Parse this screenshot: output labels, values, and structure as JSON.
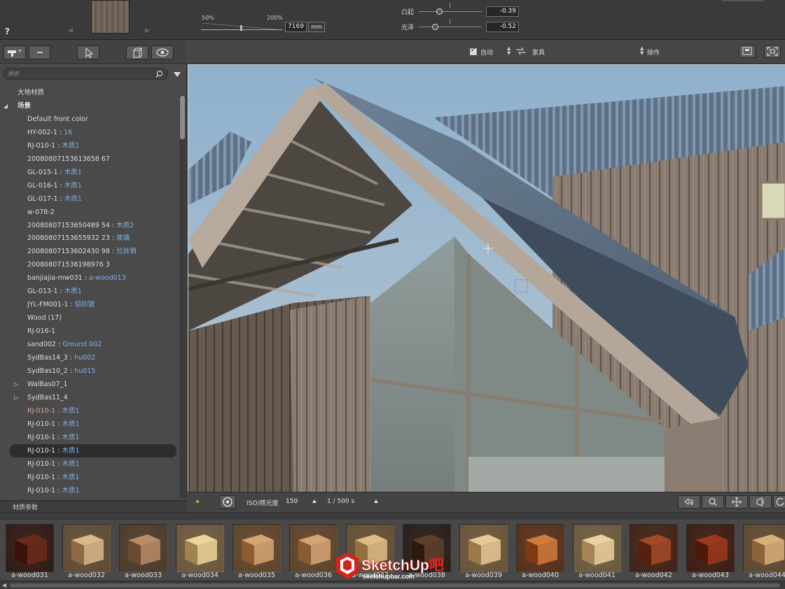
{
  "top": {
    "help": "?",
    "scale_min": "50%",
    "scale_max": "200%",
    "size_value": "7169",
    "size_unit": "mm",
    "params": [
      {
        "label": "凸起",
        "value": "-0.39",
        "level": 0.32
      },
      {
        "label": "光泽",
        "value": "-0.52",
        "level": 0.26
      }
    ]
  },
  "left": {
    "search_placeholder": "搜索",
    "tree": [
      {
        "name": "大地材质",
        "indent": 1
      },
      {
        "name": "场景",
        "indent": 1,
        "arrow": "◢",
        "bold": true
      },
      {
        "name": "Default front color",
        "indent": 2
      },
      {
        "name": "HY-002-1",
        "material": "16",
        "indent": 2
      },
      {
        "name": "RJ-010-1",
        "material": "木质1",
        "indent": 2
      },
      {
        "name": "20080807153613658 67",
        "indent": 2
      },
      {
        "name": "GL-015-1",
        "material": "木质1",
        "indent": 2
      },
      {
        "name": "GL-016-1",
        "material": "木质1",
        "indent": 2
      },
      {
        "name": "GL-017-1",
        "material": "木质1",
        "indent": 2
      },
      {
        "name": "w-078-2",
        "indent": 2
      },
      {
        "name": "20080807153650489 54",
        "material": "木质2",
        "indent": 2
      },
      {
        "name": "20080807153655932 23",
        "material": "玻璃",
        "indent": 2
      },
      {
        "name": "20080807153602430 98",
        "material": "拉丝钢",
        "indent": 2
      },
      {
        "name": "200808071536198976 3",
        "indent": 2
      },
      {
        "name": "banjiajia-mw031",
        "material": "a-wood013",
        "indent": 2
      },
      {
        "name": "GL-013-1",
        "material": "木质1",
        "indent": 2
      },
      {
        "name": "JYL-FM001-1",
        "material": "铝砂银",
        "indent": 2
      },
      {
        "name": "Wood (17)",
        "indent": 2
      },
      {
        "name": "RJ-016-1",
        "indent": 2
      },
      {
        "name": "sand002",
        "material": "Ground 002",
        "indent": 2
      },
      {
        "name": "SydBas14_3",
        "material": "hu002",
        "indent": 2
      },
      {
        "name": "SydBas10_2",
        "material": "hu015",
        "indent": 2
      },
      {
        "name": "WalBas07_1",
        "indent": 2,
        "arrow": "▷"
      },
      {
        "name": "SydBas11_4",
        "indent": 2,
        "arrow": "▷"
      },
      {
        "name": "RJ-010-1",
        "material": "木质1",
        "indent": 2,
        "red": true
      },
      {
        "name": "RJ-010-1",
        "material": "木质1",
        "indent": 2
      },
      {
        "name": "RJ-010-1",
        "material": "木质1",
        "indent": 2
      },
      {
        "name": "RJ-010-1",
        "material": "木质1",
        "indent": 2,
        "selected": true
      },
      {
        "name": "RJ-010-1",
        "material": "木质1",
        "indent": 2
      },
      {
        "name": "RJ-010-1",
        "material": "木质1",
        "indent": 2
      },
      {
        "name": "RJ-010-1",
        "material": "木质1",
        "indent": 2
      }
    ],
    "params_label": "材质参数"
  },
  "viewport_toolbar": {
    "auto_label": "自动",
    "furniture_label": "家具",
    "action_label": "操作"
  },
  "viewport_bottom": {
    "iso_label": "ISO/感光度",
    "iso_value": "150",
    "shutter_label": "1 / 500 s"
  },
  "materials": [
    {
      "name": "a-wood031",
      "c1": "#6b2a1a",
      "c2": "#3a120a"
    },
    {
      "name": "a-wood032",
      "c1": "#d9b889",
      "c2": "#8c6a44"
    },
    {
      "name": "a-wood033",
      "c1": "#b88c66",
      "c2": "#6c4a30"
    },
    {
      "name": "a-wood034",
      "c1": "#ecd49a",
      "c2": "#a08250"
    },
    {
      "name": "a-wood035",
      "c1": "#d6a672",
      "c2": "#8c5c30"
    },
    {
      "name": "a-wood036",
      "c1": "#d4a474",
      "c2": "#8a5a32"
    },
    {
      "name": "a-wood037",
      "c1": "#e0bc86",
      "c2": "#94703e"
    },
    {
      "name": "a-wood038",
      "c1": "#5e3e2a",
      "c2": "#2c1a10"
    },
    {
      "name": "a-wood039",
      "c1": "#e8c898",
      "c2": "#9c7a48"
    },
    {
      "name": "a-wood040",
      "c1": "#d07a3c",
      "c2": "#7c3a14"
    },
    {
      "name": "a-wood041",
      "c1": "#ecd0a0",
      "c2": "#a48454"
    },
    {
      "name": "a-wood042",
      "c1": "#a24a24",
      "c2": "#58200c"
    },
    {
      "name": "a-wood043",
      "c1": "#9a3a1c",
      "c2": "#501808"
    },
    {
      "name": "a-wood044",
      "c1": "#d8b07a",
      "c2": "#8a6438"
    }
  ],
  "watermark": {
    "logo_text": "SketchUp吧",
    "url": "sketchupbar.com"
  }
}
